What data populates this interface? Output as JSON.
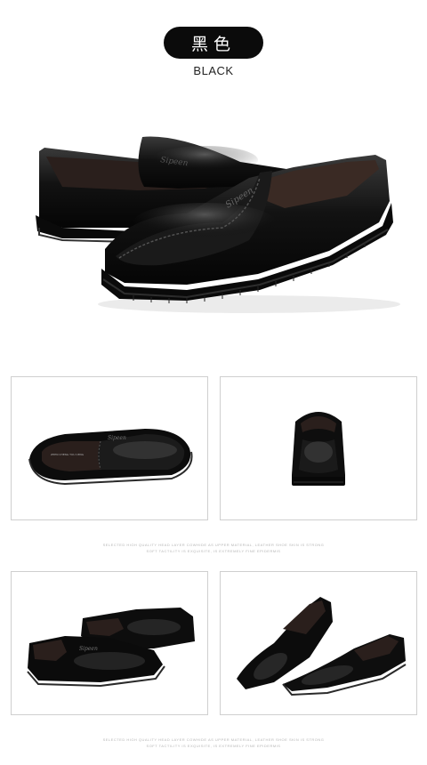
{
  "color_option": {
    "name_zh": "黑色",
    "name_en": "BLACK",
    "swatch_color": "#0b0b0b"
  },
  "product": {
    "upper_color": "#0d0d0d",
    "lining_color": "#3a2a24",
    "sole_color": "#111111"
  },
  "captions": [
    {
      "line1": "SELECTED HIGH QUALITY HEAD LAYER COWHIDE AS UPPER MATERIAL, LEATHER SHOE SKIN IS STRONG",
      "line2": "SOFT TACTILITY IS EXQUISITE, IS EXTREMELY FINE EPIDERMIS"
    },
    {
      "line1": "SELECTED HIGH QUALITY HEAD LAYER COWHIDE AS UPPER MATERIAL, LEATHER SHOE SKIN IS STRONG",
      "line2": "SOFT TACTILITY IS EXQUISITE, IS EXTREMELY FINE EPIDERMIS"
    }
  ],
  "detail_views": [
    {
      "view": "top view"
    },
    {
      "view": "rear view"
    },
    {
      "view": "pair side view"
    },
    {
      "view": "pair front view"
    }
  ]
}
